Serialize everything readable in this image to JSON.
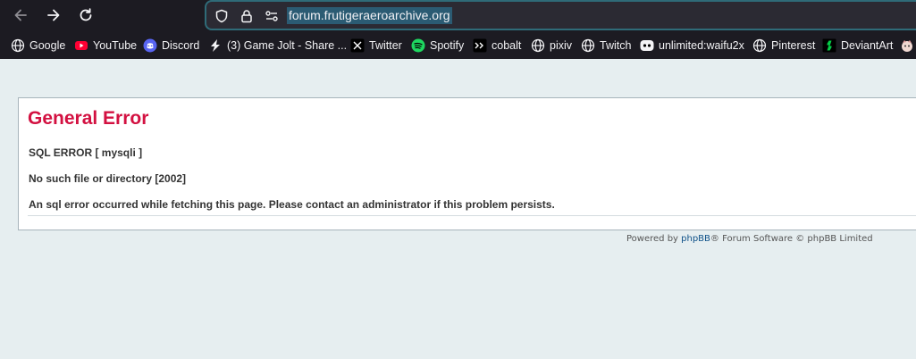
{
  "browser": {
    "url": "forum.frutigeraeroarchive.org",
    "bookmarks": [
      {
        "label": "Google",
        "icon": "globe-icon"
      },
      {
        "label": "YouTube",
        "icon": "youtube-icon"
      },
      {
        "label": "Discord",
        "icon": "discord-icon"
      },
      {
        "label": "(3) Game Jolt - Share ...",
        "icon": "gamejolt-icon"
      },
      {
        "label": "Twitter",
        "icon": "x-icon"
      },
      {
        "label": "Spotify",
        "icon": "spotify-icon"
      },
      {
        "label": "cobalt",
        "icon": "cobalt-icon"
      },
      {
        "label": "pixiv",
        "icon": "globe-icon"
      },
      {
        "label": "Twitch",
        "icon": "globe-icon"
      },
      {
        "label": "unlimited:waifu2x",
        "icon": "waifu2x-icon"
      },
      {
        "label": "Pinterest",
        "icon": "globe-icon"
      },
      {
        "label": "DeviantArt",
        "icon": "deviantart-icon"
      }
    ]
  },
  "error": {
    "title": "General Error",
    "sql_error": "SQL ERROR [ mysqli ]",
    "detail": "No such file or directory [2002]",
    "message": "An sql error occurred while fetching this page. Please contact an administrator if this problem persists."
  },
  "footer": {
    "prefix": "Powered by ",
    "link": "phpBB",
    "suffix": "® Forum Software © phpBB Limited"
  },
  "colors": {
    "title": "#d31141",
    "link": "#105289",
    "page_bg": "#e6eef0",
    "chrome_bg": "#1c1b22"
  }
}
